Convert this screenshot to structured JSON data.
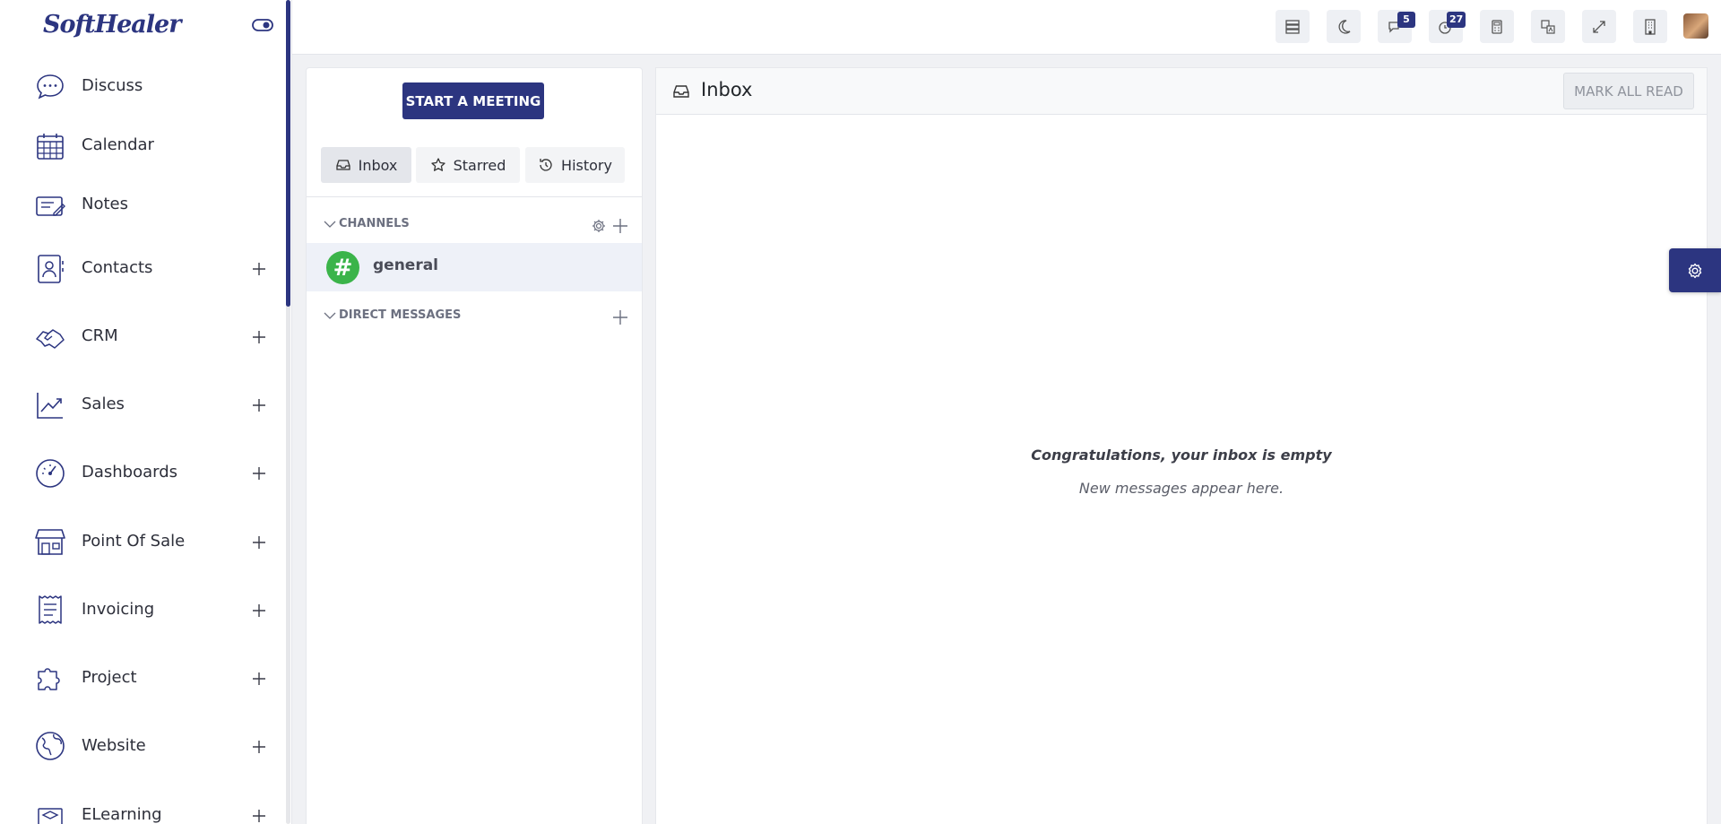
{
  "brand": {
    "logo_text": "SoftHealer",
    "accent": "#2c3580"
  },
  "sidebar": {
    "items": [
      {
        "label": "Discuss",
        "icon": "chat-bubble-icon",
        "expandable": false
      },
      {
        "label": "Calendar",
        "icon": "calendar-icon",
        "expandable": false
      },
      {
        "label": "Notes",
        "icon": "note-pencil-icon",
        "expandable": false
      },
      {
        "label": "Contacts",
        "icon": "contact-book-icon",
        "expandable": true
      },
      {
        "label": "CRM",
        "icon": "handshake-icon",
        "expandable": true
      },
      {
        "label": "Sales",
        "icon": "trend-chart-icon",
        "expandable": true
      },
      {
        "label": "Dashboards",
        "icon": "gauge-icon",
        "expandable": true
      },
      {
        "label": "Point Of Sale",
        "icon": "shop-icon",
        "expandable": true
      },
      {
        "label": "Invoicing",
        "icon": "receipt-icon",
        "expandable": true
      },
      {
        "label": "Project",
        "icon": "puzzle-icon",
        "expandable": true
      },
      {
        "label": "Website",
        "icon": "globe-icon",
        "expandable": true
      },
      {
        "label": "ELearning",
        "icon": "graduation-icon",
        "expandable": true
      }
    ]
  },
  "topbar": {
    "messages_count": "5",
    "activities_count": "27"
  },
  "discuss": {
    "start_meeting_label": "START A MEETING",
    "tabs": [
      {
        "label": "Inbox",
        "icon": "inbox-icon",
        "active": true
      },
      {
        "label": "Starred",
        "icon": "star-icon",
        "active": false
      },
      {
        "label": "History",
        "icon": "history-icon",
        "active": false
      }
    ],
    "channels_header": "CHANNELS",
    "channels": [
      {
        "name": "general",
        "avatar_glyph": "#"
      }
    ],
    "direct_messages_header": "DIRECT MESSAGES"
  },
  "main": {
    "title": "Inbox",
    "mark_all_read_label": "MARK ALL READ",
    "empty_title": "Congratulations, your inbox is empty",
    "empty_subtitle": "New messages appear here."
  }
}
